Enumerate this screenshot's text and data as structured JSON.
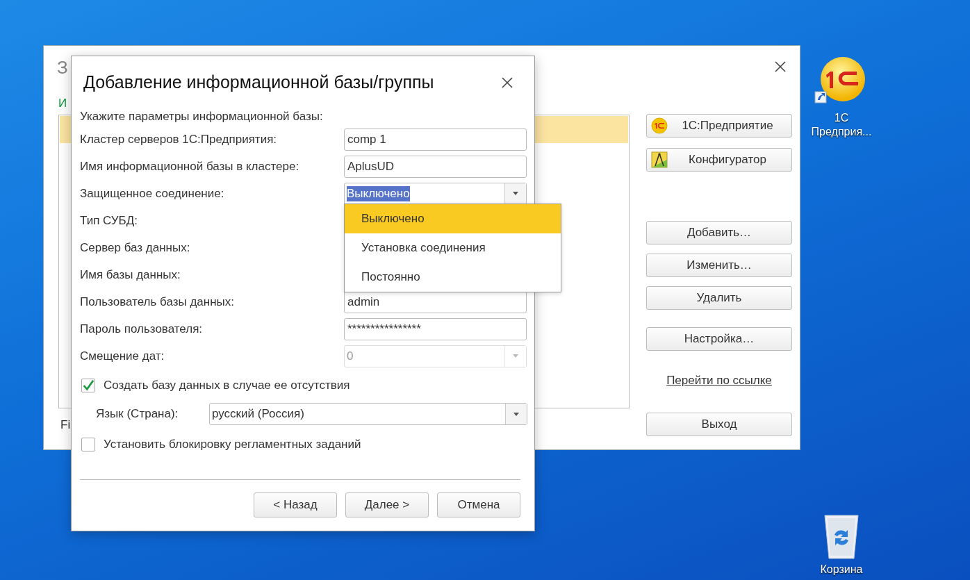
{
  "desktop": {
    "icons": [
      {
        "label": "1С Предприя...",
        "kind": "onec"
      },
      {
        "label": "Корзина",
        "kind": "bin"
      }
    ]
  },
  "main_window": {
    "title": "З",
    "section_label": "И",
    "list_rows": [
      {
        "selected": true
      }
    ],
    "footer_text": "Fi",
    "launch_buttons": [
      {
        "label": "1С:Предприятие",
        "kind": "enterprise"
      },
      {
        "label": "Конфигуратор",
        "kind": "designer"
      }
    ],
    "action_buttons": [
      "Добавить…",
      "Изменить…",
      "Удалить"
    ],
    "settings_button": "Настройка…",
    "link": "Перейти по ссылке",
    "exit_button": "Выход"
  },
  "dialog": {
    "title": "Добавление информационной базы/группы",
    "intro": "Укажите параметры информационной базы:",
    "fields": [
      {
        "label": "Кластер серверов 1С:Предприятия:",
        "kind": "text",
        "value": "comp 1"
      },
      {
        "label": "Имя информационной базы в кластере:",
        "kind": "text",
        "value": "AplusUD"
      },
      {
        "label": "Защищенное соединение:",
        "kind": "combo",
        "value": "Выключено",
        "text_selected": true,
        "disabled": false
      },
      {
        "label": "Тип СУБД:",
        "kind": "hidden"
      },
      {
        "label": "Сервер баз данных:",
        "kind": "hidden"
      },
      {
        "label": "Имя базы данных:",
        "kind": "hidden"
      },
      {
        "label": "Пользователь базы данных:",
        "kind": "text",
        "value": "admin"
      },
      {
        "label": "Пароль пользователя:",
        "kind": "text",
        "value": "****************"
      },
      {
        "label": "Смещение дат:",
        "kind": "combo",
        "value": "0",
        "text_selected": false,
        "disabled": true
      }
    ],
    "dropdown": [
      {
        "label": "Выключено",
        "selected": true
      },
      {
        "label": "Установка соединения",
        "selected": false
      },
      {
        "label": "Постоянно",
        "selected": false
      }
    ],
    "create_db": {
      "label": "Создать базу данных в случае ее отсутствия",
      "checked": true
    },
    "language": {
      "label": "Язык (Страна):",
      "value": "русский (Россия)"
    },
    "lock_jobs": {
      "label": "Установить блокировку регламентных заданий",
      "checked": false
    },
    "buttons": [
      "< Назад",
      "Далее >",
      "Отмена"
    ]
  }
}
